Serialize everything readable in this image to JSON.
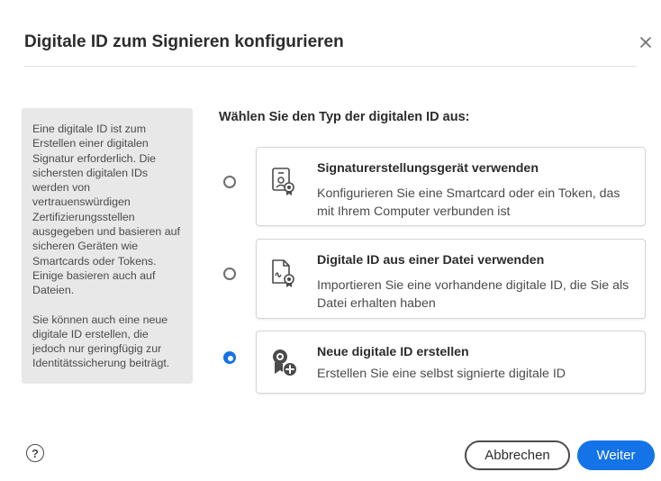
{
  "dialog": {
    "title": "Digitale ID zum Signieren konfigurieren",
    "close_icon": "close-icon"
  },
  "info": {
    "paragraph1": "Eine digitale ID ist zum Erstellen einer digitalen Signatur erforderlich. Die sichersten digitalen IDs werden von vertrauenswürdigen Zertifizierungsstellen ausgegeben und basieren auf sicheren Geräten wie Smartcards oder Tokens. Einige basieren auch auf Dateien.",
    "paragraph2": "Sie können auch eine neue digitale ID erstellen, die jedoch nur geringfügig zur Identitätssicherung beiträgt."
  },
  "prompt": "Wählen Sie den Typ der digitalen ID aus:",
  "options": [
    {
      "title": "Signaturerstellungsgerät verwenden",
      "description": "Konfigurieren Sie eine Smartcard oder ein Token, das mit Ihrem Computer verbunden ist",
      "icon": "smartcard-icon",
      "selected": false
    },
    {
      "title": "Digitale ID aus einer Datei verwenden",
      "description": "Importieren Sie eine vorhandene digitale ID, die Sie als Datei erhalten haben",
      "icon": "certificate-file-icon",
      "selected": false
    },
    {
      "title": "Neue digitale ID erstellen",
      "description": "Erstellen Sie eine selbst signierte digitale ID",
      "icon": "new-certificate-icon",
      "selected": true
    }
  ],
  "footer": {
    "help_label": "?",
    "cancel_label": "Abbrechen",
    "next_label": "Weiter"
  },
  "colors": {
    "accent": "#1473e6",
    "info_background": "#e8e8e8",
    "text": "#2c2c2c"
  }
}
